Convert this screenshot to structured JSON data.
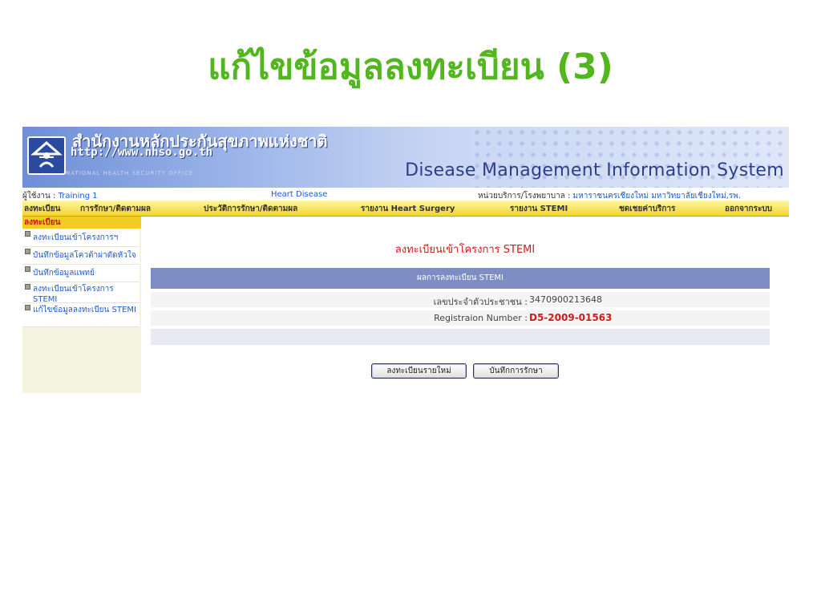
{
  "slide_title": "แก้ไขข้อมูลลงทะเบียน (3)",
  "header": {
    "org_name": "สำนักงานหลักประกันสุขภาพแห่งชาติ",
    "org_url": "http://www.nhso.go.th",
    "org_sub": "NATIONAL HEALTH SECURITY OFFICE",
    "system_title": "Disease Management Information System"
  },
  "info": {
    "user_label": "ผู้ใช้งาน : ",
    "user": "Training 1",
    "program": "Heart Disease",
    "unit_label": "หน่วยบริการ/โรงพยาบาล : ",
    "unit": "มหาราชนครเชียงใหม่ มหาวิทยาลัยเชียงใหม่,รพ."
  },
  "nav": {
    "items": [
      "ลงทะเบียน",
      "การรักษา/ติดตามผล",
      "ประวัติการรักษา/ติดตามผล",
      "รายงาน Heart Surgery",
      "รายงาน STEMI",
      "ชดเชยค่าบริการ",
      "ออกจากระบบ"
    ]
  },
  "sidebar": {
    "heading": "ลงทะเบียน",
    "items": [
      "ลงทะเบียนเข้าโครงการฯ",
      "บันทึกข้อมูลโควต้าผ่าตัดหัวใจ",
      "บันทึกข้อมูลแพทย์",
      "ลงทะเบียนเข้าโครงการ STEMI",
      "แก้ไขข้อมูลลงทะเบียน STEMI"
    ]
  },
  "main": {
    "title": "ลงทะเบียนเข้าโครงการ STEMI",
    "panel_heading": "ผลการลงทะเบียน STEMI",
    "id_label": "เลขประจำตัวประชาชน :",
    "id_value": "3470900213648",
    "reg_label": "Registraion Number :",
    "reg_value": "D5-2009-01563",
    "button_new": "ลงทะเบียนรายใหม่",
    "button_treat": "บันทึกการรักษา"
  },
  "colors": {
    "slide_title": "#52b71f",
    "accent_red": "#d11b1b",
    "link_blue": "#1f5bd6",
    "nav_yellow": "#f3d42c",
    "panel_head": "#7e8ec4"
  }
}
